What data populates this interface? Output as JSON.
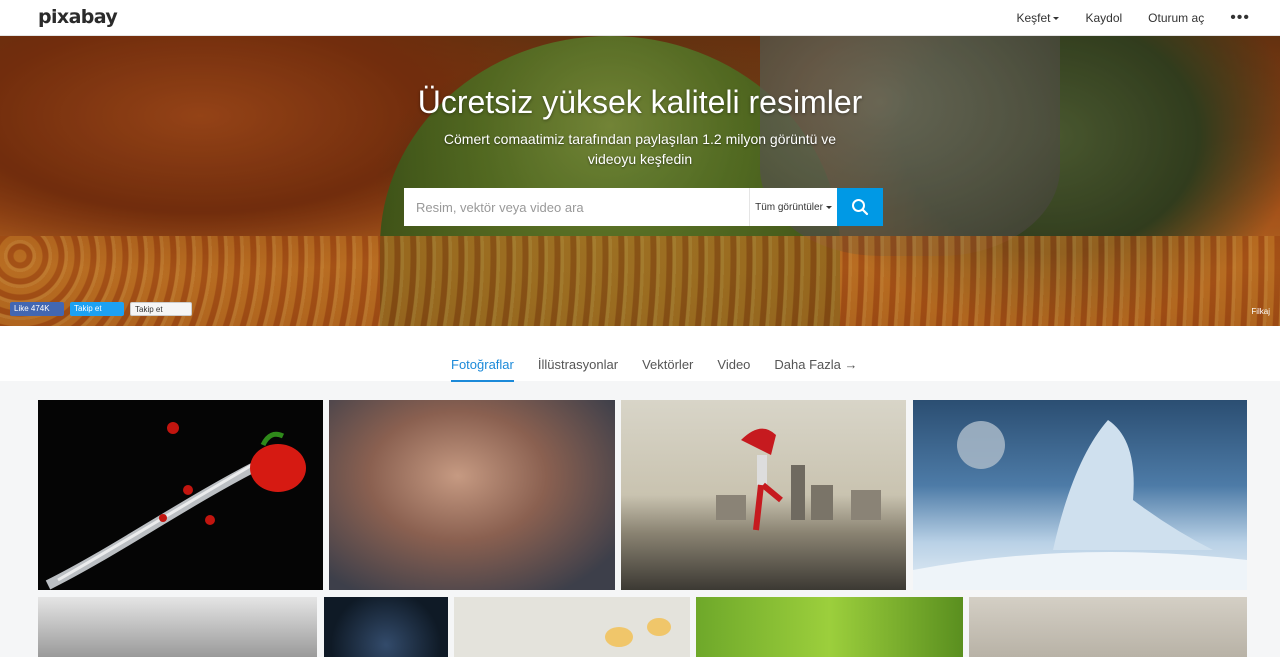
{
  "brand": {
    "logo_text": "pixabay"
  },
  "nav": {
    "explore_label": "Keşfet",
    "signup_label": "Kaydol",
    "login_label": "Oturum aç",
    "more_label": "•••"
  },
  "hero": {
    "title": "Ücretsiz yüksek kaliteli resimler",
    "subtitle": "Cömert comaatimiz tarafından paylaşılan 1.2 milyon görüntü ve videoyu keşfedin",
    "search_placeholder": "Resim, vektör veya video ara",
    "search_type_selected": "Tüm görüntüler",
    "social": {
      "facebook_label": "Like 474K",
      "twitter_label": "Takip et",
      "google_label": "Takip et"
    },
    "credit_label": "Filkaj"
  },
  "tabs": [
    {
      "label": "Fotoğraflar",
      "active": true
    },
    {
      "label": "İllüstrasyonlar",
      "active": false
    },
    {
      "label": "Vektörler",
      "active": false
    },
    {
      "label": "Video",
      "active": false
    },
    {
      "label": "Daha Fazla →",
      "active": false
    }
  ],
  "colors": {
    "accent": "#0099e5",
    "tab_active": "#1c8ad9"
  }
}
